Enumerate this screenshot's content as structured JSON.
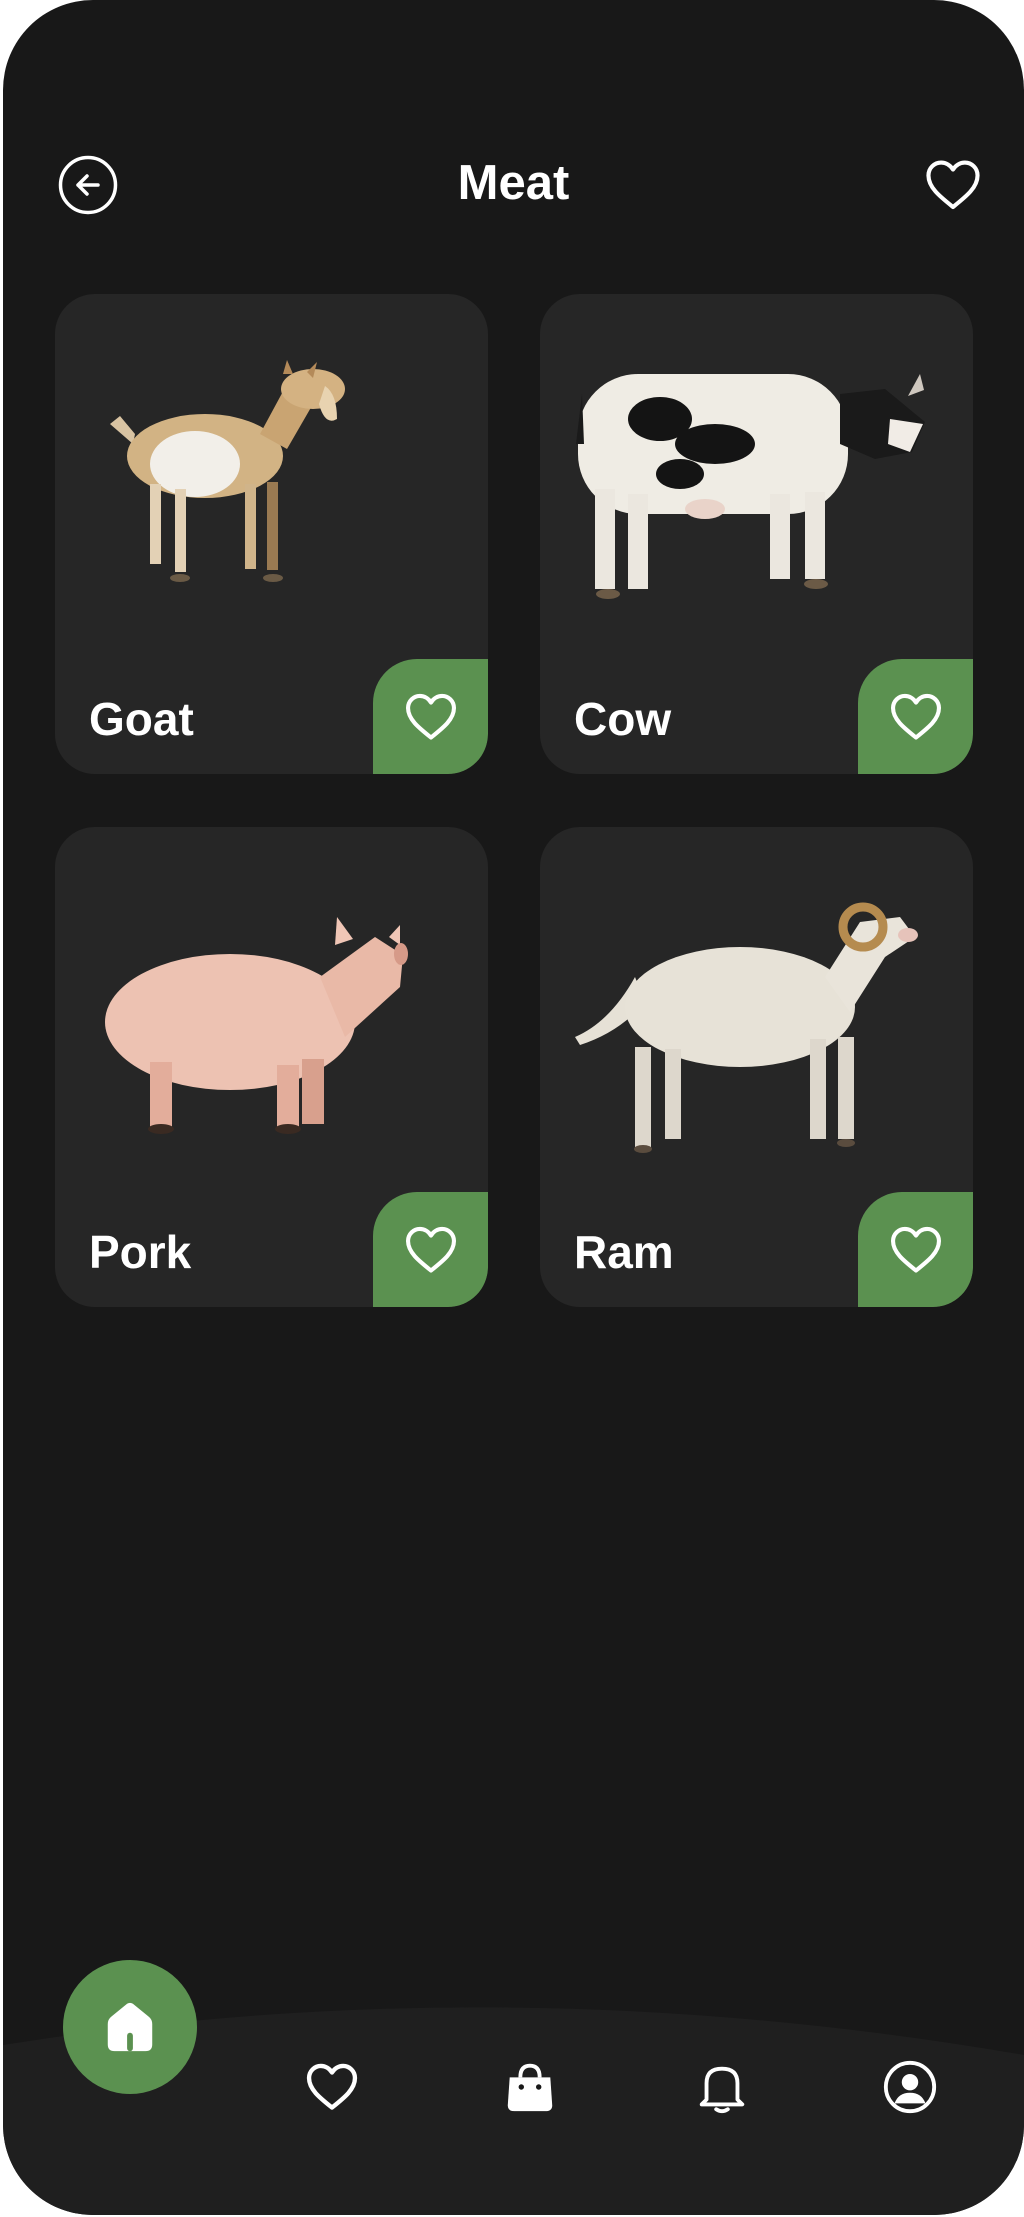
{
  "header": {
    "title": "Meat",
    "back_icon": "arrow-left-circle-icon",
    "favorite_icon": "heart-outline-icon"
  },
  "products": [
    {
      "name": "Goat",
      "image": "goat-image",
      "favorite_icon": "heart-outline-icon"
    },
    {
      "name": "Cow",
      "image": "cow-image",
      "favorite_icon": "heart-outline-icon"
    },
    {
      "name": "Pork",
      "image": "pig-image",
      "favorite_icon": "heart-outline-icon"
    },
    {
      "name": "Ram",
      "image": "ram-image",
      "favorite_icon": "heart-outline-icon"
    }
  ],
  "bottom_nav": {
    "items": [
      "home-icon",
      "heart-outline-icon",
      "shopping-bag-icon",
      "bell-icon",
      "user-circle-icon"
    ],
    "active": "home-icon"
  },
  "colors": {
    "background": "#181818",
    "card": "#262626",
    "accent": "#5b9150",
    "text": "#ffffff"
  }
}
